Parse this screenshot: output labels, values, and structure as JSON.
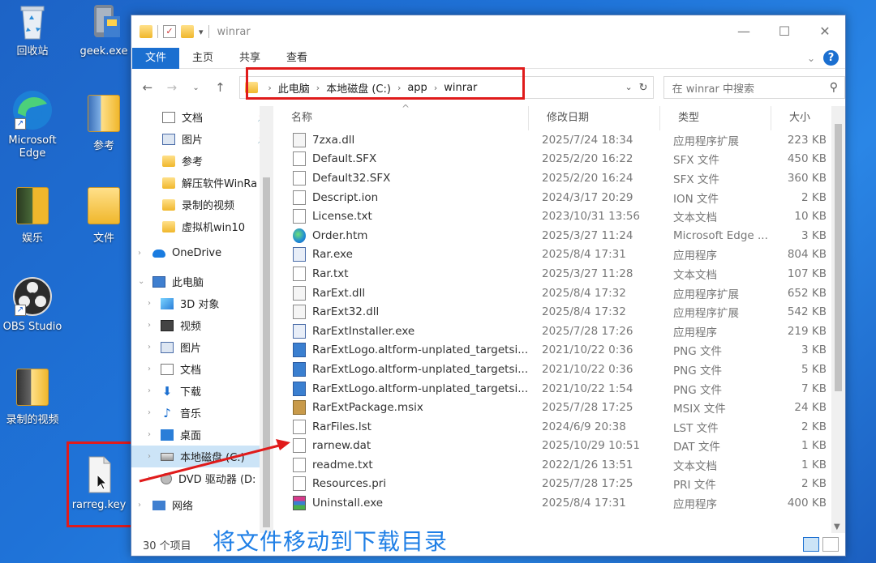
{
  "desktop": {
    "icons": [
      {
        "label": "回收站",
        "icon": "recycle-bin-icon"
      },
      {
        "label": "geek.exe",
        "icon": "geek-app-icon"
      },
      {
        "label": "Microsoft Edge",
        "icon": "edge-icon"
      },
      {
        "label": "参考",
        "icon": "folder-icon"
      },
      {
        "label": "娱乐",
        "icon": "folder-icon"
      },
      {
        "label": "文件",
        "icon": "folder-icon"
      },
      {
        "label": "OBS Studio",
        "icon": "obs-icon"
      },
      {
        "label": "录制的视频",
        "icon": "folder-icon"
      },
      {
        "label": "rarreg.key",
        "icon": "key-file-icon"
      }
    ]
  },
  "window": {
    "title": "winrar",
    "controls": [
      "—",
      "☐",
      "✕"
    ],
    "ribbon_tabs": [
      "文件",
      "主页",
      "共享",
      "查看"
    ],
    "address": {
      "crumbs": [
        "此电脑",
        "本地磁盘 (C:)",
        "app",
        "winrar"
      ]
    },
    "search_placeholder": "在 winrar 中搜索",
    "nav": {
      "quick": [
        {
          "label": "文档",
          "icon": "documents-icon",
          "pinned": true
        },
        {
          "label": "图片",
          "icon": "pictures-icon",
          "pinned": true
        },
        {
          "label": "参考",
          "icon": "folder-icon"
        },
        {
          "label": "解压软件WinRa",
          "icon": "folder-icon"
        },
        {
          "label": "录制的视频",
          "icon": "folder-icon"
        },
        {
          "label": "虚拟机win10",
          "icon": "folder-icon"
        }
      ],
      "onedrive": "OneDrive",
      "this_pc": "此电脑",
      "pc_items": [
        {
          "label": "3D 对象",
          "icon": "3d-objects-icon"
        },
        {
          "label": "视频",
          "icon": "videos-icon"
        },
        {
          "label": "图片",
          "icon": "pictures-icon"
        },
        {
          "label": "文档",
          "icon": "documents-icon"
        },
        {
          "label": "下载",
          "icon": "downloads-icon"
        },
        {
          "label": "音乐",
          "icon": "music-icon"
        },
        {
          "label": "桌面",
          "icon": "desktop-icon"
        },
        {
          "label": "本地磁盘 (C:)",
          "icon": "drive-icon"
        },
        {
          "label": "DVD 驱动器 (D:",
          "icon": "dvd-icon"
        }
      ],
      "network": "网络"
    },
    "columns": [
      "名称",
      "修改日期",
      "类型",
      "大小"
    ],
    "files": [
      {
        "name": "7zxa.dll",
        "date": "2025/7/24 18:34",
        "type": "应用程序扩展",
        "size": "223 KB",
        "icon": "dll"
      },
      {
        "name": "Default.SFX",
        "date": "2025/2/20 16:22",
        "type": "SFX 文件",
        "size": "450 KB",
        "icon": "file"
      },
      {
        "name": "Default32.SFX",
        "date": "2025/2/20 16:24",
        "type": "SFX 文件",
        "size": "360 KB",
        "icon": "file"
      },
      {
        "name": "Descript.ion",
        "date": "2024/3/17 20:29",
        "type": "ION 文件",
        "size": "2 KB",
        "icon": "file"
      },
      {
        "name": "License.txt",
        "date": "2023/10/31 13:56",
        "type": "文本文档",
        "size": "10 KB",
        "icon": "file"
      },
      {
        "name": "Order.htm",
        "date": "2025/3/27 11:24",
        "type": "Microsoft Edge ...",
        "size": "3 KB",
        "icon": "edge"
      },
      {
        "name": "Rar.exe",
        "date": "2025/8/4 17:31",
        "type": "应用程序",
        "size": "804 KB",
        "icon": "exe"
      },
      {
        "name": "Rar.txt",
        "date": "2025/3/27 11:28",
        "type": "文本文档",
        "size": "107 KB",
        "icon": "file"
      },
      {
        "name": "RarExt.dll",
        "date": "2025/8/4 17:32",
        "type": "应用程序扩展",
        "size": "652 KB",
        "icon": "dll"
      },
      {
        "name": "RarExt32.dll",
        "date": "2025/8/4 17:32",
        "type": "应用程序扩展",
        "size": "542 KB",
        "icon": "dll"
      },
      {
        "name": "RarExtInstaller.exe",
        "date": "2025/7/28 17:26",
        "type": "应用程序",
        "size": "219 KB",
        "icon": "exe"
      },
      {
        "name": "RarExtLogo.altform-unplated_targetsi...",
        "date": "2021/10/22 0:36",
        "type": "PNG 文件",
        "size": "3 KB",
        "icon": "png"
      },
      {
        "name": "RarExtLogo.altform-unplated_targetsi...",
        "date": "2021/10/22 0:36",
        "type": "PNG 文件",
        "size": "5 KB",
        "icon": "png"
      },
      {
        "name": "RarExtLogo.altform-unplated_targetsi...",
        "date": "2021/10/22 1:54",
        "type": "PNG 文件",
        "size": "7 KB",
        "icon": "png"
      },
      {
        "name": "RarExtPackage.msix",
        "date": "2025/7/28 17:25",
        "type": "MSIX 文件",
        "size": "24 KB",
        "icon": "msix"
      },
      {
        "name": "RarFiles.lst",
        "date": "2024/6/9 20:38",
        "type": "LST 文件",
        "size": "2 KB",
        "icon": "file"
      },
      {
        "name": "rarnew.dat",
        "date": "2025/10/29 10:51",
        "type": "DAT 文件",
        "size": "1 KB",
        "icon": "file"
      },
      {
        "name": "readme.txt",
        "date": "2022/1/26 13:51",
        "type": "文本文档",
        "size": "1 KB",
        "icon": "file"
      },
      {
        "name": "Resources.pri",
        "date": "2025/7/28 17:25",
        "type": "PRI 文件",
        "size": "2 KB",
        "icon": "file"
      },
      {
        "name": "Uninstall.exe",
        "date": "2025/8/4 17:31",
        "type": "应用程序",
        "size": "400 KB",
        "icon": "rar"
      }
    ],
    "status": "30 个项目"
  },
  "caption": "将文件移动到下载目录",
  "colors": {
    "highlight": "#e01b1b",
    "accent": "#1b6fd0",
    "caption": "#1f7fe6"
  }
}
